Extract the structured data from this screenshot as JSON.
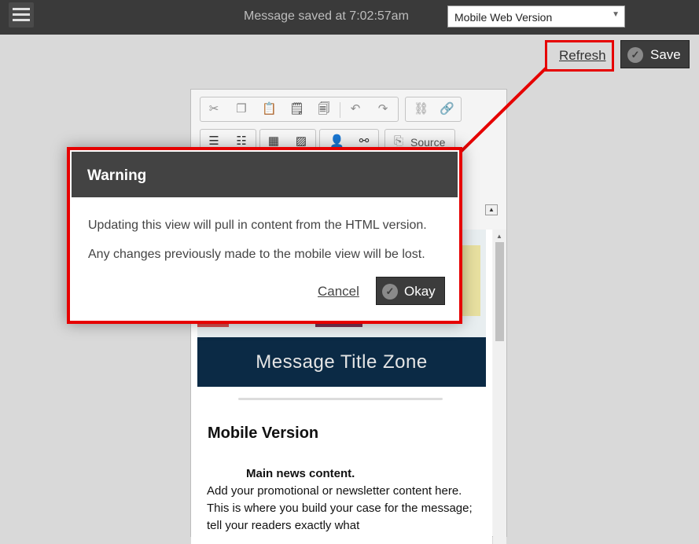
{
  "topbar": {
    "status": "Message saved at 7:02:57am",
    "view_select": {
      "value": "Mobile Web Version"
    }
  },
  "actions": {
    "refresh_label": "Refresh",
    "save_label": "Save"
  },
  "editor": {
    "toolbar": {
      "source_label": "Source",
      "icons": [
        "cut-icon",
        "copy-icon",
        "paste-icon",
        "paste-text-icon",
        "paste-word-icon",
        "undo-icon",
        "redo-icon",
        "unlink-icon",
        "link-icon",
        "numbered-list-icon",
        "bulleted-list-icon",
        "table-icon",
        "image-icon",
        "person-icon",
        "share-icon",
        "source-icon"
      ]
    },
    "content": {
      "title_zone": "Message Title Zone",
      "heading": "Mobile Version",
      "main_heading": "Main news content.",
      "body": "Add your promotional or newsletter content here. This is where you build your case for the message; tell your readers exactly what"
    }
  },
  "modal": {
    "title": "Warning",
    "line1": "Updating this view will pull in content from the HTML version.",
    "line2": "Any changes previously made to the mobile view will be lost.",
    "cancel_label": "Cancel",
    "okay_label": "Okay"
  },
  "colors": {
    "highlight": "#e60000",
    "topbar": "#3a3a3a",
    "title_zone": "#0b2a45"
  }
}
